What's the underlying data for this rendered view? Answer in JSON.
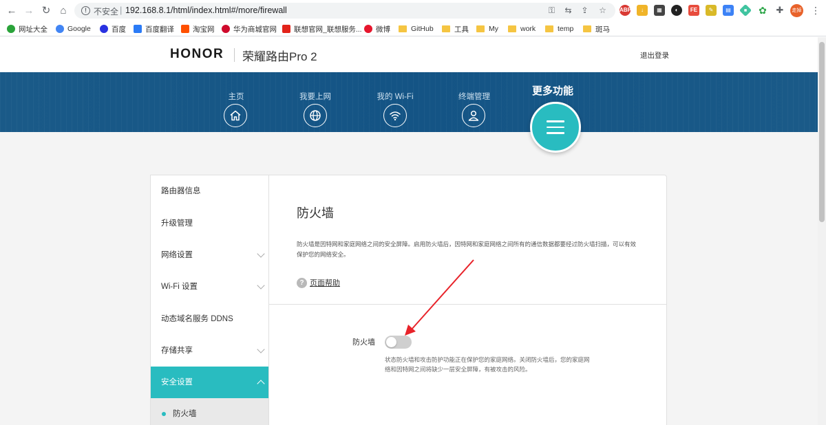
{
  "browser": {
    "url_insecure": "不安全",
    "url_separator": "|",
    "url": "192.168.8.1/html/index.html#/more/firewall",
    "avatar_label": "走掉"
  },
  "bookmarks": [
    {
      "label": "网址大全",
      "color": "#2aa33a"
    },
    {
      "label": "Google",
      "color": "#4285f4"
    },
    {
      "label": "百度",
      "color": "#2932e1"
    },
    {
      "label": "百度翻译",
      "color": "#2b7bf6"
    },
    {
      "label": "淘宝网",
      "color": "#ff5000"
    },
    {
      "label": "华为商城官网",
      "color": "#cf0a2c"
    },
    {
      "label": "联想官网_联想服务...",
      "color": "#e2231a"
    },
    {
      "label": "微博",
      "color": "#e6162d"
    },
    {
      "label": "GitHub",
      "color": "#f5c542"
    },
    {
      "label": "工具",
      "color": "#f5c542"
    },
    {
      "label": "My",
      "color": "#f5c542"
    },
    {
      "label": "work",
      "color": "#f5c542"
    },
    {
      "label": "temp",
      "color": "#f5c542"
    },
    {
      "label": "斑马",
      "color": "#f5c542"
    }
  ],
  "header": {
    "brand": "HONOR",
    "product": "荣耀路由Pro 2",
    "logout": "退出登录"
  },
  "nav": {
    "items": [
      {
        "label": "主页",
        "icon": "home-icon"
      },
      {
        "label": "我要上网",
        "icon": "globe-icon"
      },
      {
        "label": "我的 Wi-Fi",
        "icon": "wifi-icon"
      },
      {
        "label": "终端管理",
        "icon": "user-icon"
      }
    ],
    "more": "更多功能"
  },
  "sidebar": {
    "items": [
      {
        "label": "路由器信息"
      },
      {
        "label": "升级管理"
      },
      {
        "label": "网络设置"
      },
      {
        "label": "Wi-Fi 设置"
      },
      {
        "label": "动态域名服务 DDNS"
      },
      {
        "label": "存储共享"
      },
      {
        "label": "安全设置"
      },
      {
        "label": "防火墙"
      }
    ]
  },
  "main": {
    "title": "防火墙",
    "description": "防火墙是因特网和家庭网络之间的安全屏障。启用防火墙后，因特网和家庭网络之间所有的通信数据都要经过防火墙扫描，可以有效保护您的网络安全。",
    "help": "页面帮助",
    "firewall_label": "防火墙",
    "firewall_enabled": false,
    "firewall_desc": "状态防火墙和攻击防护功能正在保护您的家庭网络。关闭防火墙后，您的家庭网络和因特网之间将缺少一层安全屏障，有被攻击的风险。"
  },
  "colors": {
    "accent": "#29bcc0",
    "hero": "#145485",
    "annotation_arrow": "#e8232a"
  }
}
